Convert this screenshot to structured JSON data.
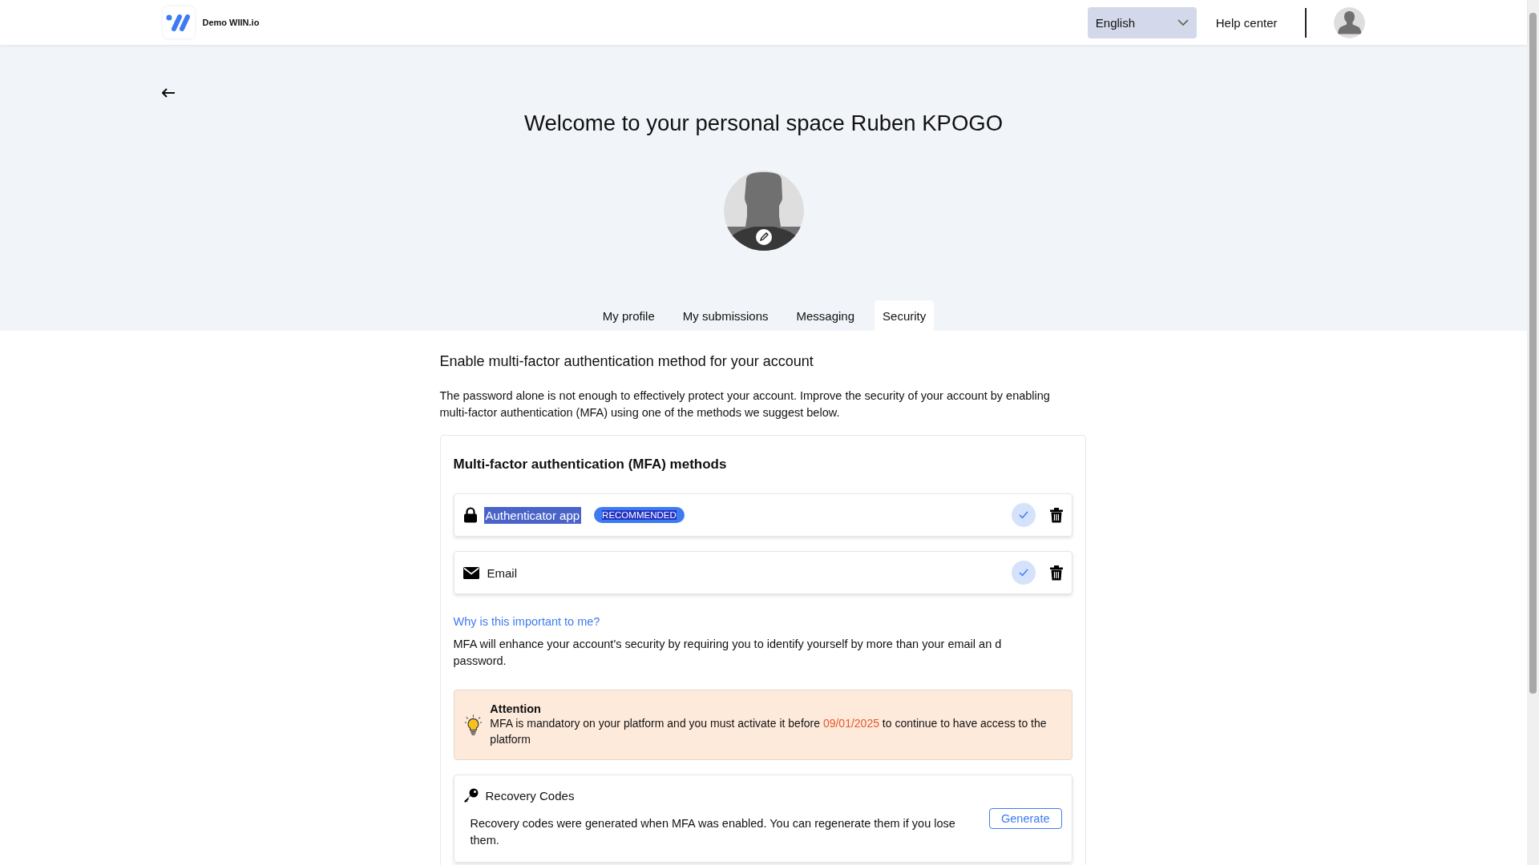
{
  "header": {
    "brand": "Demo WIIN.io",
    "language": "English",
    "help_link": "Help center"
  },
  "page": {
    "title": "Welcome to your personal space Ruben KPOGO"
  },
  "tabs": [
    {
      "label": "My profile",
      "selected": false
    },
    {
      "label": "My submissions",
      "selected": false
    },
    {
      "label": "Messaging",
      "selected": false
    },
    {
      "label": "Security",
      "selected": true
    }
  ],
  "section": {
    "heading": "Enable multi-factor authentication method for your account",
    "intro": "The password alone is not enough to effectively protect your account. Improve the security of your account by enabling multi-factor authentication (MFA) using one of the methods we suggest below."
  },
  "mfa_card": {
    "title": "Multi-factor authentication (MFA) methods",
    "methods": [
      {
        "kind": "app",
        "label": "Authenticator app",
        "badge": "RECOMMENDED",
        "enabled": true,
        "text_selected": true
      },
      {
        "kind": "email",
        "label": "Email",
        "enabled": true,
        "text_selected": false
      }
    ],
    "why_link": "Why is this important to me?",
    "why_text": "MFA will enhance your account's security by requiring you to identify yourself by more than your email an d password.",
    "alert": {
      "title": "Attention",
      "text_before": "MFA is mandatory on your platform and you must activate it before ",
      "date": "09/01/2025",
      "text_after": " to continue to have access to the platform"
    },
    "recovery": {
      "title": "Recovery Codes",
      "text": "Recovery codes were generated when MFA was enabled. You can regenerate them if you lose them.",
      "button": "Generate"
    }
  }
}
